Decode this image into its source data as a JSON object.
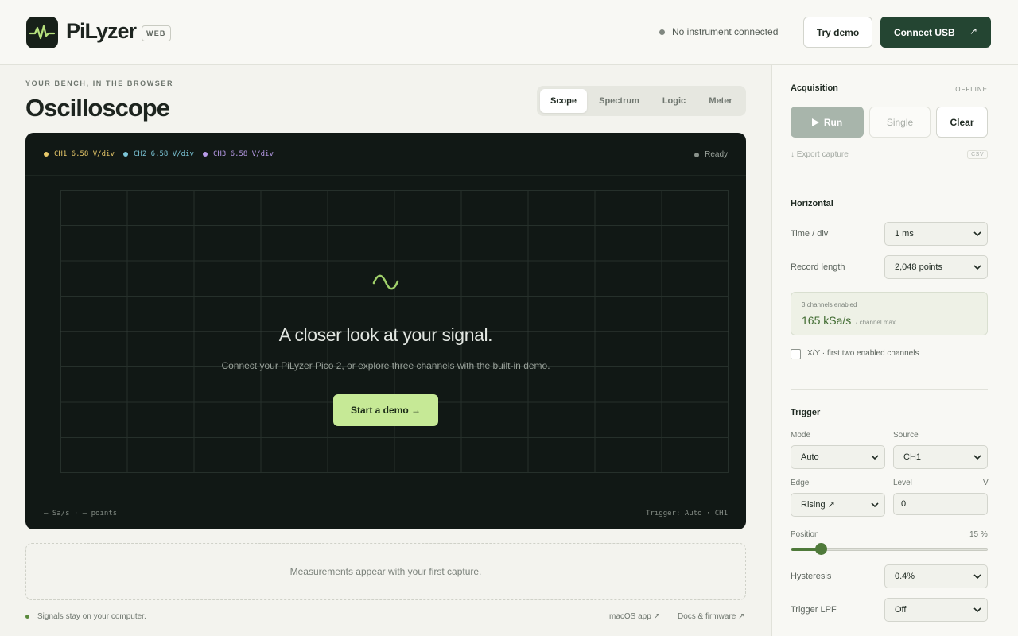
{
  "app": {
    "name": "PiLyzer",
    "badge": "WEB"
  },
  "header": {
    "status_text": "No instrument connected",
    "try_demo_label": "Try demo",
    "connect_usb_label": "Connect USB",
    "connect_usb_icon": "↗"
  },
  "main": {
    "eyebrow": "YOUR BENCH, IN THE BROWSER",
    "title": "Oscilloscope",
    "tabs": [
      {
        "label": "Scope",
        "active": true
      },
      {
        "label": "Spectrum",
        "active": false
      },
      {
        "label": "Logic",
        "active": false
      },
      {
        "label": "Meter",
        "active": false
      }
    ]
  },
  "scope": {
    "channels": [
      {
        "label": "CH1 6.58 V/div",
        "color": "#e8c96a"
      },
      {
        "label": "CH2 6.58 V/div",
        "color": "#7cc6d8"
      },
      {
        "label": "CH3 6.58 V/div",
        "color": "#b89be8"
      }
    ],
    "state": "Ready",
    "overlay_title": "A closer look at your signal.",
    "overlay_subtitle": "Connect your PiLyzer Pico 2, or explore three channels with the built-in demo.",
    "start_demo_label": "Start a demo →",
    "footer_left": "— Sa/s · — points",
    "footer_right": "Trigger: Auto · CH1"
  },
  "measurements": {
    "placeholder": "Measurements appear with your first capture."
  },
  "footer": {
    "privacy_note": "Signals stay on your computer.",
    "macos_link": "macOS app ↗",
    "docs_link": "Docs & firmware ↗"
  },
  "panel": {
    "acquisition": {
      "heading": "Acquisition",
      "status": "OFFLINE",
      "run_label": "Run",
      "single_label": "Single",
      "clear_label": "Clear",
      "export_label": "↓ Export capture",
      "export_format": "CSV"
    },
    "horizontal": {
      "heading": "Horizontal",
      "time_div_label": "Time / div",
      "time_div_value": "1 ms",
      "record_length_label": "Record length",
      "record_length_value": "2,048 points",
      "channels_enabled": "3 channels enabled",
      "sample_rate": "165 kSa/s",
      "sample_rate_note": "/ channel max",
      "xy_label": "X/Y · first two enabled channels"
    },
    "trigger": {
      "heading": "Trigger",
      "mode_label": "Mode",
      "mode_value": "Auto",
      "source_label": "Source",
      "source_value": "CH1",
      "edge_label": "Edge",
      "edge_value": "Rising ↗",
      "level_label": "Level",
      "level_unit": "V",
      "level_value": "0",
      "position_label": "Position",
      "position_value": "15 %",
      "position_fraction": 0.15,
      "hysteresis_label": "Hysteresis",
      "hysteresis_value": "0.4%",
      "lpf_label": "Trigger LPF",
      "lpf_value": "Off"
    }
  },
  "colors": {
    "accent": "#244532",
    "demo_button": "#c6e996",
    "scope_bg": "#111815"
  }
}
